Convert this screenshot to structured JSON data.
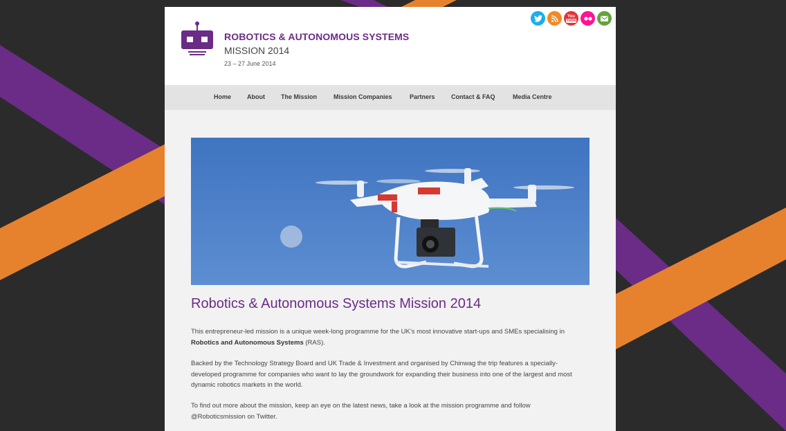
{
  "colors": {
    "background": "#2b2b2b",
    "stripe_purple": "#6a2c86",
    "stripe_orange": "#e6822e",
    "accent_purple": "#6a2c86",
    "nav_bg": "#e3e3e3",
    "page_bg": "#f2f2f2"
  },
  "header": {
    "logo_icon": "robot-icon",
    "title": "ROBOTICS & AUTONOMOUS SYSTEMS",
    "subtitle": "MISSION 2014",
    "dates": "23 – 27 June 2014"
  },
  "social": [
    {
      "name": "twitter",
      "icon": "twitter-icon",
      "color": "#1daeea",
      "glyph": "t"
    },
    {
      "name": "rss",
      "icon": "rss-icon",
      "color": "#f18a24",
      "glyph": "◥"
    },
    {
      "name": "youtube",
      "icon": "youtube-icon",
      "color": "#e2333a",
      "glyph": "You"
    },
    {
      "name": "flickr",
      "icon": "flickr-icon",
      "color": "#ff1493",
      "glyph": "●●"
    },
    {
      "name": "email",
      "icon": "email-icon",
      "color": "#64a43a",
      "glyph": "✉"
    }
  ],
  "nav": {
    "items": [
      "Home",
      "About",
      "The Mission",
      "Mission Companies",
      "Partners",
      "Contact & FAQ",
      "Media Centre"
    ]
  },
  "hero": {
    "image": "drone-photo",
    "sky_color": "#4a7bc4"
  },
  "main": {
    "heading": "Robotics & Autonomous Systems Mission 2014",
    "p1": {
      "text_a": "This entrepreneur-led mission is a unique week-long programme for the UK’s most innovative start-ups and SMEs specialising in ",
      "strong": "Robotics and Autonomous Systems",
      "link": "(RAS)",
      "text_b": "."
    },
    "p2": {
      "text_a": "Backed by the ",
      "link1": "Technology Strategy Board",
      "text_b": " and ",
      "link2": "UK Trade & Investment",
      "text_c": " and organised by ",
      "link3": "Chinwag",
      "text_d": " the trip features a ",
      "link4": "specially-developed programme",
      "text_e": " for companies who want to lay the groundwork for expanding their business into one of the largest and most dynamic robotics markets in the world."
    },
    "p3": {
      "text_a": "To find out more about the mission, keep an eye on the ",
      "link1": "latest news",
      "text_b": ", take a look at the ",
      "link2": "mission programme",
      "text_c": " and follow ",
      "link3": "@Roboticsmission",
      "text_d": " on Twitter."
    }
  }
}
